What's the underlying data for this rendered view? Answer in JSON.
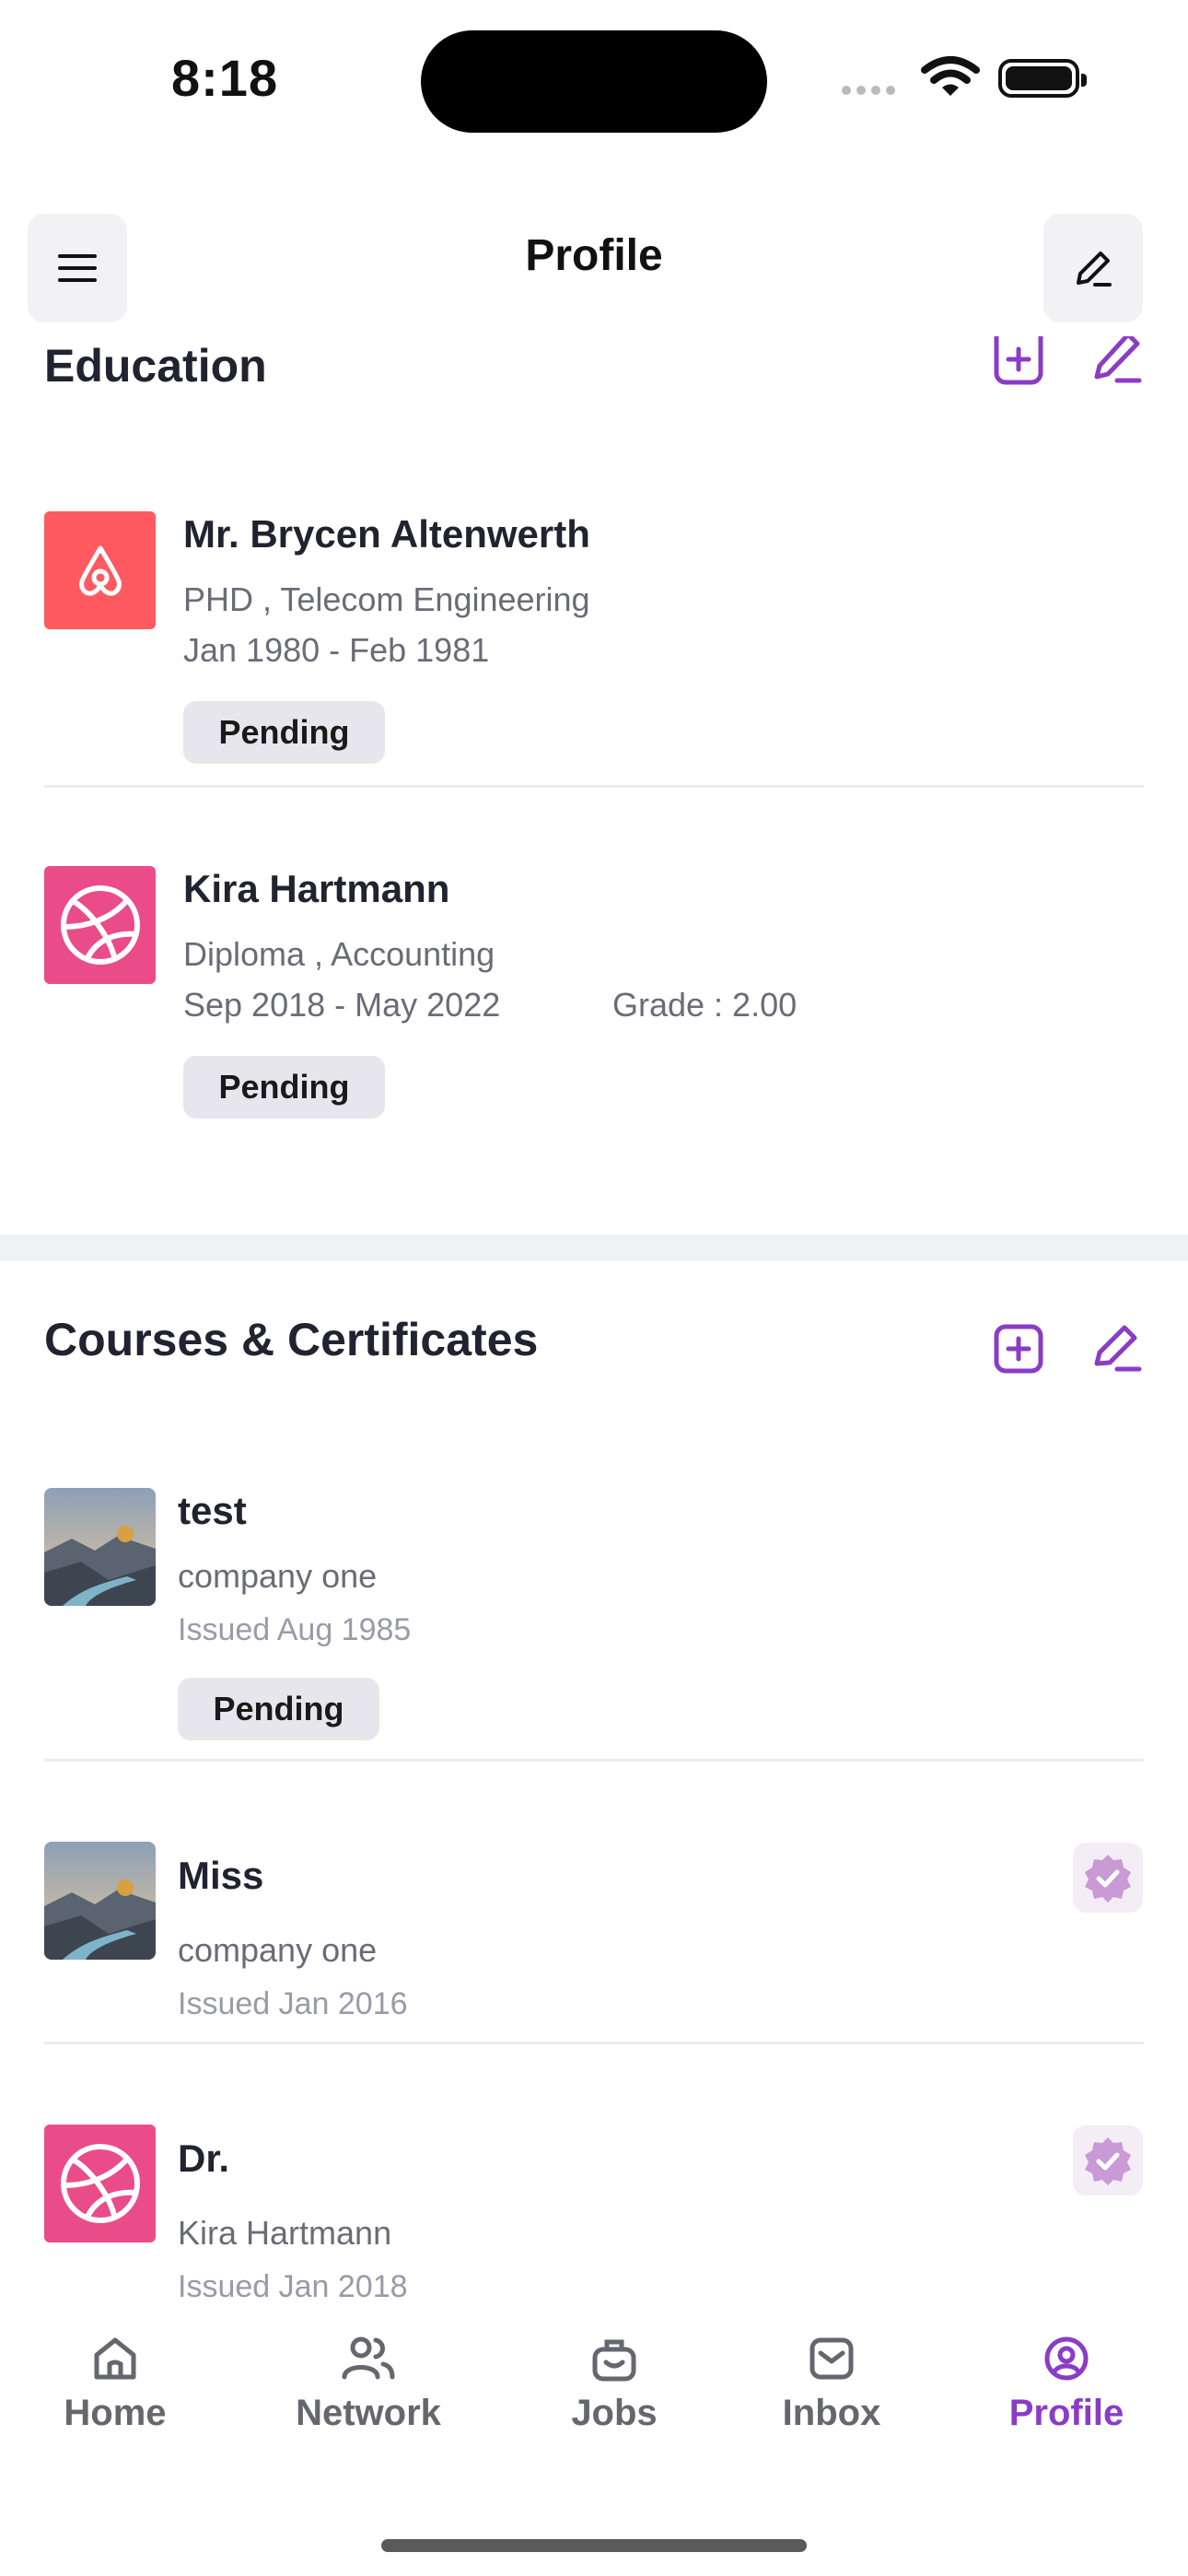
{
  "status": {
    "time": "8:18"
  },
  "header": {
    "title": "Profile"
  },
  "education": {
    "title": "Education",
    "items": [
      {
        "name": "Mr. Brycen Altenwerth",
        "degree": "PHD , Telecom Engineering",
        "dates": "Jan 1980 - Feb 1981",
        "grade": "",
        "status": "Pending",
        "logo": "airbnb-icon"
      },
      {
        "name": "Kira Hartmann",
        "degree": "Diploma , Accounting",
        "dates": "Sep 2018 - May 2022",
        "grade": "Grade : 2.00",
        "status": "Pending",
        "logo": "dribbble-icon"
      }
    ]
  },
  "courses": {
    "title": "Courses & Certificates",
    "items": [
      {
        "name": "test",
        "issuer": "company one",
        "issued": "Issued Aug 1985",
        "status": "Pending",
        "logo": "landscape-photo"
      },
      {
        "name": "Miss",
        "issuer": "company one",
        "issued": "Issued Jan 2016",
        "verified": true,
        "logo": "landscape-photo"
      },
      {
        "name": "Dr.",
        "issuer": "Kira Hartmann",
        "issued": "Issued Jan 2018",
        "verified": true,
        "logo": "dribbble-icon"
      }
    ]
  },
  "nav": {
    "items": [
      {
        "label": "Home",
        "icon": "home-icon"
      },
      {
        "label": "Network",
        "icon": "network-icon"
      },
      {
        "label": "Jobs",
        "icon": "jobs-icon"
      },
      {
        "label": "Inbox",
        "icon": "inbox-icon"
      },
      {
        "label": "Profile",
        "icon": "profile-icon",
        "active": true
      }
    ]
  },
  "colors": {
    "accent": "#8a3cc7",
    "airbnb": "#ff5a5f",
    "dribbble": "#ea4c89",
    "badge_bg": "#e6e6ec"
  }
}
